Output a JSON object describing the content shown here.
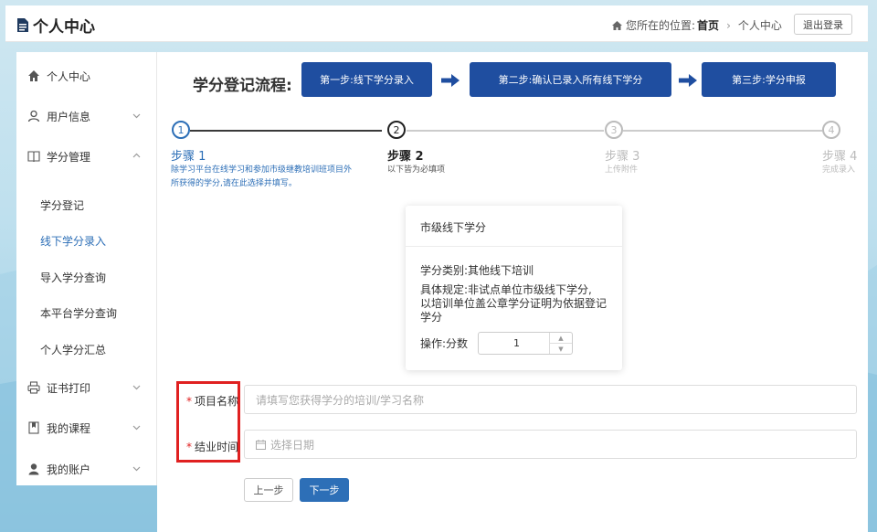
{
  "header": {
    "title": "个人中心",
    "location_label": "您所在的位置:",
    "breadcrumb": [
      "首页",
      "个人中心"
    ],
    "logout": "退出登录"
  },
  "sidebar": {
    "items": [
      {
        "label": "个人中心",
        "icon": "home-icon"
      },
      {
        "label": "用户信息",
        "icon": "user-icon",
        "expandable": true
      },
      {
        "label": "学分管理",
        "icon": "book-icon",
        "expanded": true
      },
      {
        "label": "证书打印",
        "icon": "printer-icon",
        "expandable": true
      },
      {
        "label": "我的课程",
        "icon": "bookmark-icon",
        "expandable": true
      },
      {
        "label": "我的账户",
        "icon": "account-icon",
        "expandable": true
      }
    ],
    "sub_items": [
      {
        "label": "学分登记",
        "active": false
      },
      {
        "label": "线下学分录入",
        "active": true
      },
      {
        "label": "导入学分查询",
        "active": false
      },
      {
        "label": "本平台学分查询",
        "active": false
      },
      {
        "label": "个人学分汇总",
        "active": false
      }
    ]
  },
  "flow": {
    "title": "学分登记流程:",
    "steps": [
      "第一步:线下学分录入",
      "第二步:确认已录入所有线下学分",
      "第三步:学分申报"
    ]
  },
  "steps": [
    {
      "num": "1",
      "title": "步骤 1",
      "desc": [
        "除学习平台在线学习和参加市级继教培训班项目外",
        "所获得的学分,请在此选择并填写。"
      ],
      "state": "done"
    },
    {
      "num": "2",
      "title": "步骤 2",
      "desc": [
        "以下皆为必填项"
      ],
      "state": "current"
    },
    {
      "num": "3",
      "title": "步骤 3",
      "desc": [
        "上传附件"
      ],
      "state": "pending"
    },
    {
      "num": "4",
      "title": "步骤 4",
      "desc": [
        "完成录入"
      ],
      "state": "pending"
    }
  ],
  "card": {
    "title": "市级线下学分",
    "category": "学分类别:其他线下培训",
    "rule": [
      "具体规定:非试点单位市级线下学分,",
      "以培训单位盖公章学分证明为依据登记",
      "学分"
    ],
    "operation_label": "操作:分数",
    "score_value": "1"
  },
  "form": {
    "project_label": "项目名称",
    "project_placeholder": "请填写您获得学分的培训/学习名称",
    "end_label": "结业时间",
    "end_placeholder": "选择日期"
  },
  "buttons": {
    "prev": "上一步",
    "next": "下一步"
  },
  "colors": {
    "accent": "#2d6fb7",
    "flow_box": "#1f4ea0",
    "required": "#e02020"
  }
}
